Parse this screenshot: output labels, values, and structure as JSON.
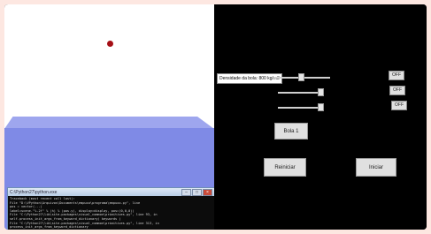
{
  "scene": {},
  "console": {
    "title": "C:\\Python27\\python.exe",
    "minimize": "–",
    "maximize": "□",
    "close": "×",
    "lines": [
      "Traceback (most recent call last):",
      "  File \"D:\\VPython\\Arquivos\\Documents\\empuxo\\programa\\empuxo.py\", line",
      "    pos = vector(...)",
      "    label=scene.\"%.2f\" % (h) % (pos.y), display=display, pos=(0,0,0))",
      "  File \"C:\\Python27\\lib\\site-packages\\visual_common\\primitives.py\", line 93, in",
      "    self.process_init_args_from_keyword_dictionary( keywords )",
      "  File \"C:\\Python27\\lib\\site-packages\\visual_common\\primitives.py\", line 313, in",
      "    process_init_args_from_keyword_dictionary"
    ]
  },
  "panel": {
    "density_label": "Densidade da bola: 800 kg/m3",
    "sliders": [
      {
        "name": "ball-density",
        "value": 0.48
      },
      {
        "name": "slider-2",
        "value": 0.96
      },
      {
        "name": "slider-3",
        "value": 0.96
      }
    ],
    "toggles": [
      "OFF",
      "OFF",
      "OFF"
    ],
    "mode_button": "Bola 1",
    "reset_button": "Reiniciar",
    "start_button": "Iniciar"
  }
}
